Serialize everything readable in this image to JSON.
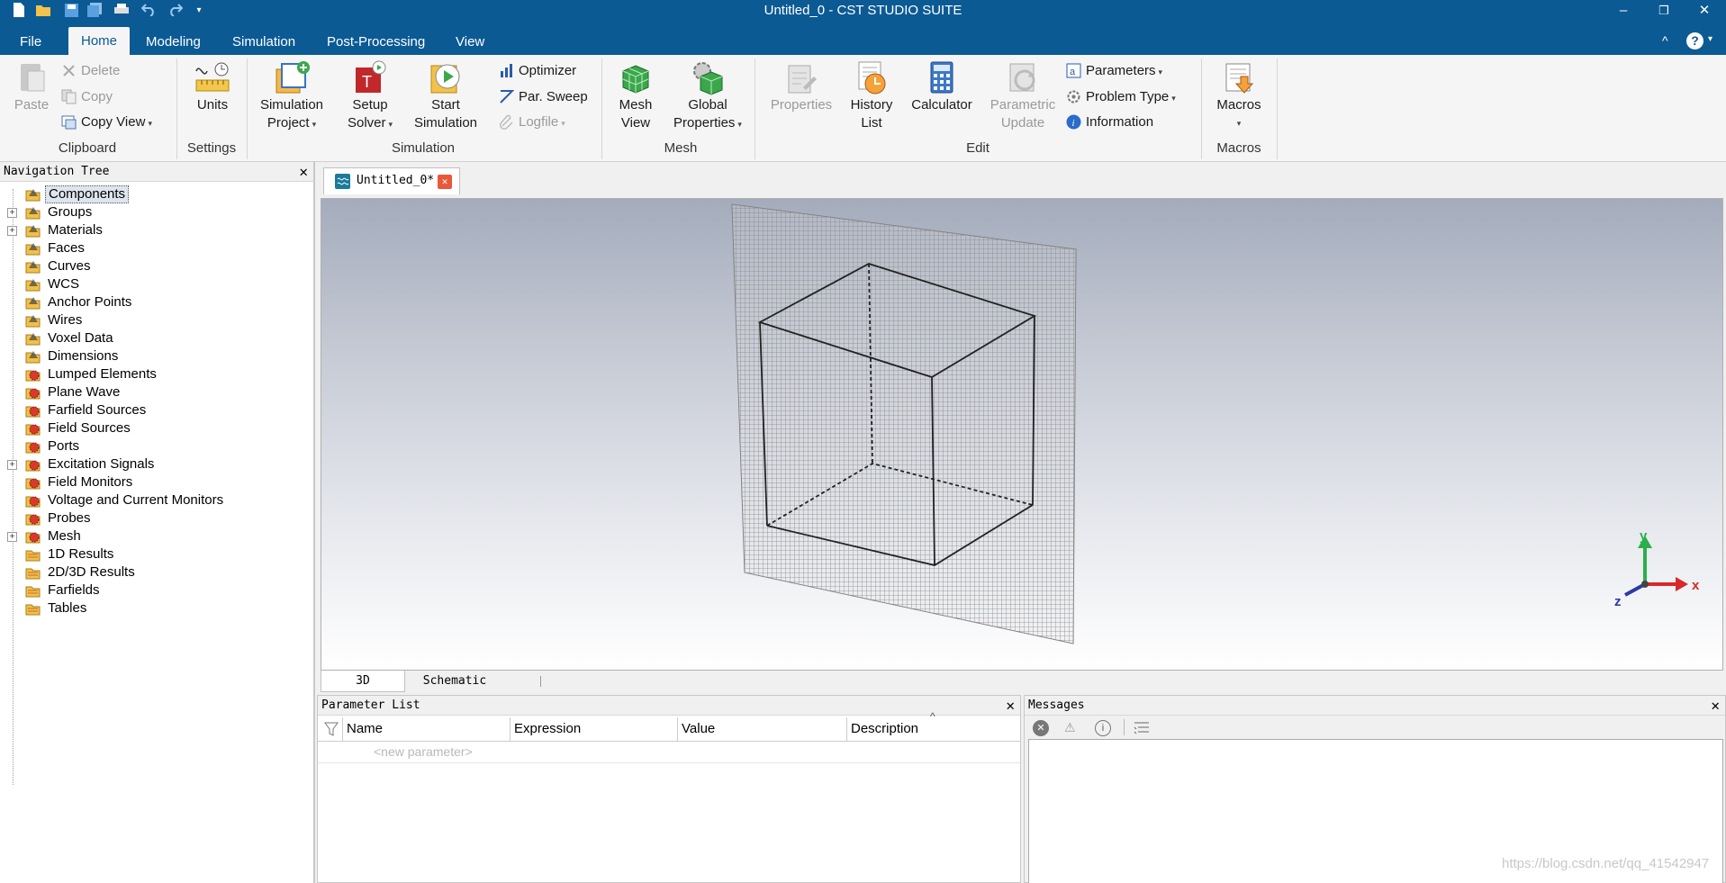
{
  "app": {
    "title": "Untitled_0 - CST STUDIO SUITE"
  },
  "titlebar": {
    "qat_icons": [
      "new-icon",
      "open-icon",
      "save-icon",
      "save-all-icon",
      "print-icon",
      "undo-icon",
      "redo-icon",
      "customize-icon"
    ],
    "window_buttons": {
      "minimize": "–",
      "restore": "❐",
      "close": "✕"
    }
  },
  "ribbon_tabs": [
    "File",
    "Home",
    "Modeling",
    "Simulation",
    "Post-Processing",
    "View"
  ],
  "ribbon_tabs_active": "Home",
  "ribbon": {
    "clipboard": {
      "paste": "Paste",
      "delete": "Delete",
      "copy": "Copy",
      "copy_view": "Copy View",
      "group": "Clipboard"
    },
    "settings": {
      "units": "Units",
      "group": "Settings"
    },
    "simulation": {
      "sim_project_1": "Simulation",
      "sim_project_2": "Project",
      "setup_1": "Setup",
      "setup_2": "Solver",
      "start_1": "Start",
      "start_2": "Simulation",
      "optimizer": "Optimizer",
      "par_sweep": "Par. Sweep",
      "logfile": "Logfile",
      "group": "Simulation"
    },
    "mesh": {
      "mesh_view_1": "Mesh",
      "mesh_view_2": "View",
      "global_1": "Global",
      "global_2": "Properties",
      "group": "Mesh"
    },
    "edit": {
      "properties": "Properties",
      "history_1": "History",
      "history_2": "List",
      "calculator": "Calculator",
      "param_update_1": "Parametric",
      "param_update_2": "Update",
      "parameters": "Parameters",
      "problem_type": "Problem Type",
      "information": "Information",
      "group": "Edit"
    },
    "macros": {
      "macros": "Macros",
      "group": "Macros"
    },
    "help": {
      "collapse": "^",
      "help": "?"
    }
  },
  "nav": {
    "title": "Navigation Tree",
    "items": [
      {
        "label": "Components",
        "expandable": false,
        "selected": true,
        "icon": "folder-icon"
      },
      {
        "label": "Groups",
        "expandable": true,
        "icon": "folder-icon"
      },
      {
        "label": "Materials",
        "expandable": true,
        "icon": "folder-icon"
      },
      {
        "label": "Faces",
        "expandable": false,
        "icon": "folder-icon"
      },
      {
        "label": "Curves",
        "expandable": false,
        "icon": "folder-icon"
      },
      {
        "label": "WCS",
        "expandable": false,
        "icon": "folder-icon"
      },
      {
        "label": "Anchor Points",
        "expandable": false,
        "icon": "folder-icon"
      },
      {
        "label": "Wires",
        "expandable": false,
        "icon": "folder-icon"
      },
      {
        "label": "Voxel Data",
        "expandable": false,
        "icon": "folder-icon"
      },
      {
        "label": "Dimensions",
        "expandable": false,
        "icon": "folder-icon"
      },
      {
        "label": "Lumped Elements",
        "expandable": false,
        "icon": "gear-folder-icon"
      },
      {
        "label": "Plane Wave",
        "expandable": false,
        "icon": "gear-folder-icon"
      },
      {
        "label": "Farfield Sources",
        "expandable": false,
        "icon": "gear-folder-icon"
      },
      {
        "label": "Field Sources",
        "expandable": false,
        "icon": "gear-folder-icon"
      },
      {
        "label": "Ports",
        "expandable": false,
        "icon": "gear-folder-icon"
      },
      {
        "label": "Excitation Signals",
        "expandable": true,
        "icon": "gear-folder-icon"
      },
      {
        "label": "Field Monitors",
        "expandable": false,
        "icon": "gear-folder-icon"
      },
      {
        "label": "Voltage and Current Monitors",
        "expandable": false,
        "icon": "gear-folder-icon"
      },
      {
        "label": "Probes",
        "expandable": false,
        "icon": "gear-folder-icon"
      },
      {
        "label": "Mesh",
        "expandable": true,
        "icon": "gear-folder-icon"
      },
      {
        "label": "1D Results",
        "expandable": false,
        "icon": "results-folder-icon"
      },
      {
        "label": "2D/3D Results",
        "expandable": false,
        "icon": "results-folder-icon"
      },
      {
        "label": "Farfields",
        "expandable": false,
        "icon": "results-folder-icon"
      },
      {
        "label": "Tables",
        "expandable": false,
        "icon": "results-folder-icon"
      }
    ]
  },
  "doc_tab": {
    "label": "Untitled_0*"
  },
  "viewport": {
    "axes": {
      "x": "x",
      "y": "y",
      "z": "z"
    }
  },
  "view_tabs": [
    "3D",
    "Schematic"
  ],
  "params": {
    "title": "Parameter List",
    "columns": [
      "Name",
      "Expression",
      "Value",
      "Description"
    ],
    "new_placeholder": "<new parameter>"
  },
  "messages": {
    "title": "Messages"
  },
  "watermark": "https://blog.csdn.net/qq_41542947"
}
